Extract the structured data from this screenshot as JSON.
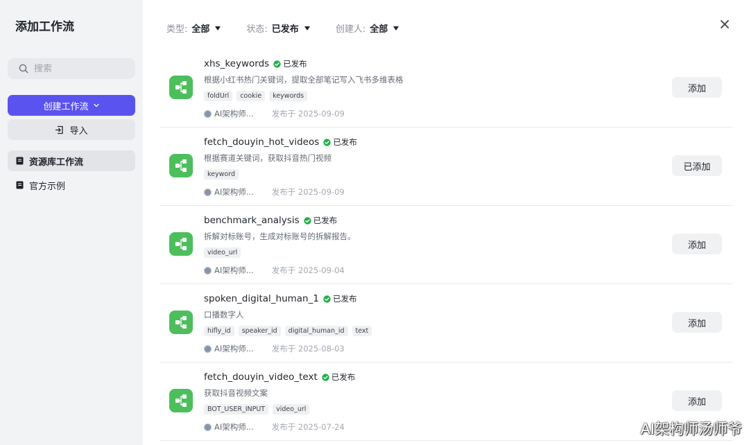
{
  "dialog": {
    "title": "添加工作流"
  },
  "sidebar": {
    "search": {
      "placeholder": "搜索",
      "icon": "search-icon"
    },
    "create_button": {
      "label": "创建工作流",
      "icon": "chevron-down-icon",
      "color": "#5a53f0"
    },
    "import_button": {
      "label": "导入",
      "icon": "import-icon"
    },
    "nav": [
      {
        "label": "资源库工作流",
        "active": true,
        "icon": "library-icon"
      },
      {
        "label": "官方示例",
        "active": false,
        "icon": "library-icon"
      }
    ]
  },
  "filters": [
    {
      "label": "类型:",
      "value": "全部"
    },
    {
      "label": "状态:",
      "value": "已发布"
    },
    {
      "label": "创建人:",
      "value": "全部"
    }
  ],
  "close_icon": "close-icon",
  "workflows": [
    {
      "name": "xhs_keywords",
      "status": "已发布",
      "description": "根据小红书热门关键词，提取全部笔记写入飞书多维表格",
      "tags": [
        "foldUrl",
        "cookie",
        "keywords"
      ],
      "author": "AI架构师...",
      "published": "发布于 2025-09-09",
      "action": "添加"
    },
    {
      "name": "fetch_douyin_hot_videos",
      "status": "已发布",
      "description": "根据赛道关键词，获取抖音热门视频",
      "tags": [
        "keyword"
      ],
      "author": "AI架构师...",
      "published": "发布于 2025-09-09",
      "action": "已添加"
    },
    {
      "name": "benchmark_analysis",
      "status": "已发布",
      "description": "拆解对标账号，生成对标账号的拆解报告。",
      "tags": [
        "video_url"
      ],
      "author": "AI架构师...",
      "published": "发布于 2025-09-04",
      "action": "添加"
    },
    {
      "name": "spoken_digital_human_1",
      "status": "已发布",
      "description": "口播数字人",
      "tags": [
        "hifly_id",
        "speaker_id",
        "digital_human_id",
        "text"
      ],
      "author": "AI架构师...",
      "published": "发布于 2025-08-03",
      "action": "添加"
    },
    {
      "name": "fetch_douyin_video_text",
      "status": "已发布",
      "description": "获取抖音视频文案",
      "tags": [
        "BOT_USER_INPUT",
        "video_url"
      ],
      "author": "AI架构师...",
      "published": "发布于 2025-07-24",
      "action": "添加"
    }
  ],
  "colors": {
    "workflow_icon": "#4cbf5c",
    "published_dot": "#22b04b",
    "accent": "#5a53f0"
  },
  "watermark": "AI架构师汤师爷"
}
